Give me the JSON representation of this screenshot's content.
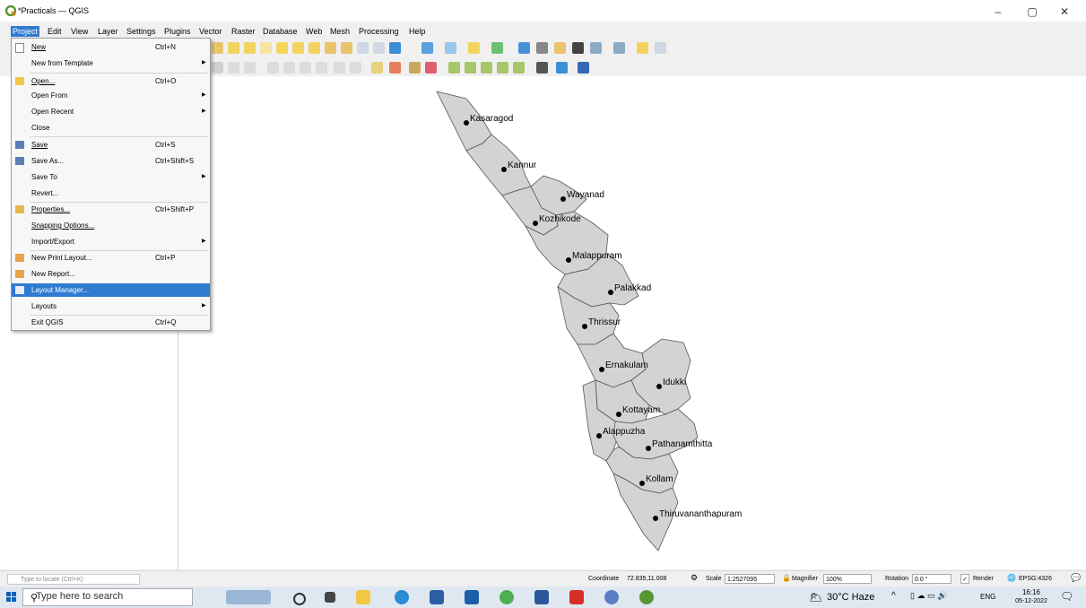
{
  "window": {
    "title": "*Practicals — QGIS",
    "minimize": "–",
    "maximize": "▢",
    "close": "✕"
  },
  "menubar": [
    "Project",
    "Edit",
    "View",
    "Layer",
    "Settings",
    "Plugins",
    "Vector",
    "Raster",
    "Database",
    "Web",
    "Mesh",
    "Processing",
    "Help"
  ],
  "project_menu": {
    "items": [
      {
        "label": "New",
        "shortcut": "Ctrl+N"
      },
      {
        "label": "New from Template",
        "shortcut": ""
      },
      {
        "label": "Open...",
        "shortcut": "Ctrl+O"
      },
      {
        "label": "Open From",
        "shortcut": ""
      },
      {
        "label": "Open Recent",
        "shortcut": ""
      },
      {
        "label": "Close",
        "shortcut": ""
      },
      {
        "label": "Save",
        "shortcut": "Ctrl+S"
      },
      {
        "label": "Save As...",
        "shortcut": "Ctrl+Shift+S"
      },
      {
        "label": "Save To",
        "shortcut": ""
      },
      {
        "label": "Revert...",
        "shortcut": ""
      },
      {
        "label": "Properties...",
        "shortcut": "Ctrl+Shift+P"
      },
      {
        "label": "Snapping Options...",
        "shortcut": ""
      },
      {
        "label": "Import/Export",
        "shortcut": ""
      },
      {
        "label": "New Print Layout...",
        "shortcut": "Ctrl+P"
      },
      {
        "label": "New Report...",
        "shortcut": ""
      },
      {
        "label": "Layout Manager...",
        "shortcut": ""
      },
      {
        "label": "Layouts",
        "shortcut": ""
      },
      {
        "label": "Exit QGIS",
        "shortcut": "Ctrl+Q"
      }
    ]
  },
  "map": {
    "districts": [
      "Kasaragod",
      "Kannur",
      "Wayanad",
      "Kozhikode",
      "Malappuram",
      "Palakkad",
      "Thrissur",
      "Ernakulam",
      "Idukki",
      "Kottayam",
      "Alappuzha",
      "Pathanamthitta",
      "Kollam",
      "Thiruvananthapuram"
    ],
    "fill": "#d3d3d3",
    "stroke": "#555555"
  },
  "statusbar": {
    "locate_placeholder": "Type to locate (Ctrl+K)",
    "coordinate_label": "Coordinate",
    "coordinate_value": "72.835,11.008",
    "scale_label": "Scale",
    "scale_value": "1:2527095",
    "magnifier_label": "Magnifier",
    "magnifier_value": "100%",
    "rotation_label": "Rotation",
    "rotation_value": "0.0 °",
    "render_label": "Render",
    "crs": "EPSG:4326"
  },
  "taskbar": {
    "search_placeholder": "Type here to search",
    "weather": "30°C Haze",
    "lang": "ENG",
    "time": "16:16",
    "date": "05-12-2022"
  },
  "colors": {
    "accent": "#2f7bd1",
    "map_fill": "#d3d3d3"
  }
}
